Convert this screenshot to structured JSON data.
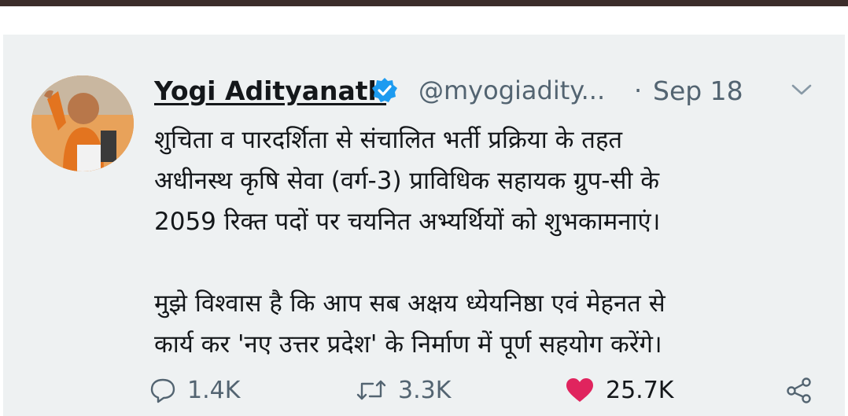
{
  "tweet": {
    "author_name": "Yogi Adityanath",
    "handle": "@myogiadity...",
    "separator": "·",
    "date": "Sep 18",
    "lines": [
      "शुचिता व पारदर्शिता से संचालित भर्ती प्रक्रिया के तहत",
      "अधीनस्थ कृषि सेवा (वर्ग-3) प्राविधिक सहायक ग्रुप-सी के",
      "2059 रिक्त पदों पर चयनित अभ्यर्थियों को शुभकामनाएं।",
      "",
      "मुझे विश्वास है कि आप सब अक्षय ध्येयनिष्ठा एवं मेहनत से",
      "कार्य कर 'नए उत्तर प्रदेश' के निर्माण में पूर्ण सहयोग करेंगे।"
    ]
  },
  "actions": {
    "replies": "1.4K",
    "retweets": "3.3K",
    "likes": "25.7K"
  },
  "icons": {
    "verified": "verified-badge-icon",
    "reply": "reply-icon",
    "retweet": "retweet-icon",
    "like": "heart-icon",
    "share": "share-icon",
    "more": "chevron-down-icon"
  },
  "colors": {
    "verified_blue": "#1d9bf0",
    "like_red": "#e0245e",
    "muted_text": "#536471",
    "card_bg": "#eef1f2"
  }
}
